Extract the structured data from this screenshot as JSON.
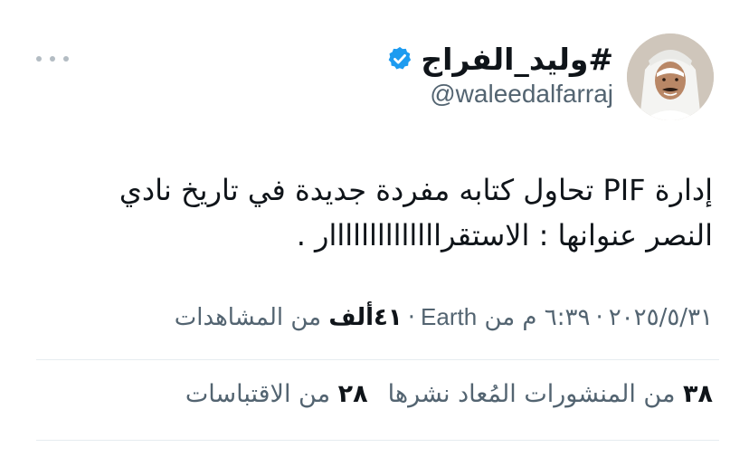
{
  "author": {
    "display_name": "#وليد_الفراج",
    "handle": "@waleedalfarraj",
    "verified_icon": "verified-badge-icon",
    "avatar_icon": "profile-avatar"
  },
  "tweet": {
    "line1": "إدارة PIF تحاول كتابه مفردة جديدة في تاريخ نادي",
    "line2": "النصر عنوانها : الاستقراااااااااااااار ."
  },
  "meta": {
    "date": "٢٠٢٥/٥/٣١",
    "time": "٦:٣٩ م",
    "from": "من",
    "source": "Earth",
    "views_count": "٤١ألف",
    "views_label": "من المشاهدات",
    "separator": "·"
  },
  "stats": {
    "reposts_count": "٣٨",
    "reposts_label": "من المنشورات المُعاد نشرها",
    "quotes_count": "٢٨",
    "quotes_label": "من الاقتباسات"
  },
  "colors": {
    "text": "#0f1419",
    "secondary": "#536471",
    "verified": "#1d9bf0",
    "divider": "#e6ecf0"
  }
}
